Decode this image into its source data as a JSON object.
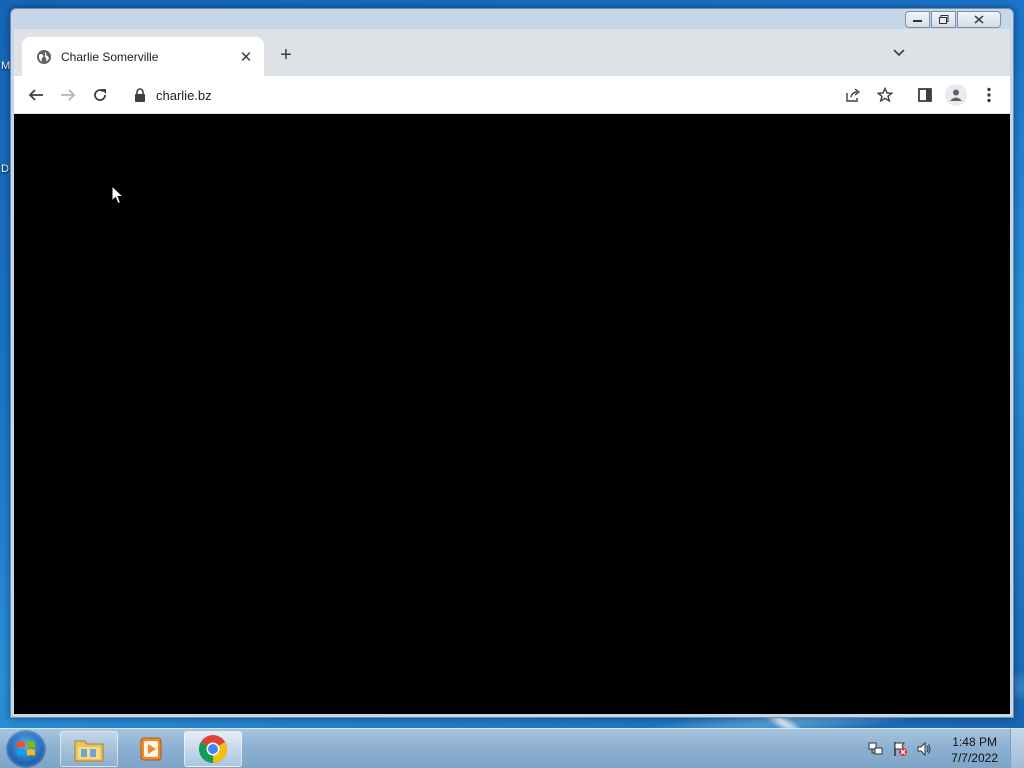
{
  "desktop": {
    "label_top": "M",
    "label_mid": "D"
  },
  "browser": {
    "tab": {
      "title": "Charlie Somerville",
      "favicon": "globe-icon"
    },
    "omnibox": {
      "url": "charlie.bz",
      "icon": "lock-icon"
    },
    "toolbar_icons": [
      "back-icon",
      "forward-icon",
      "reload-icon",
      "share-icon",
      "star-icon",
      "side-panel-icon",
      "profile-icon",
      "menu-icon"
    ],
    "page_background": "#000000"
  },
  "taskbar": {
    "apps": [
      "file-explorer",
      "media-player",
      "chrome"
    ],
    "active_app": "chrome",
    "clock": {
      "time": "1:48 PM",
      "date": "7/7/2022"
    }
  },
  "colors": {
    "tabstrip": "#dee1e6",
    "accent": "#1a73e8"
  }
}
